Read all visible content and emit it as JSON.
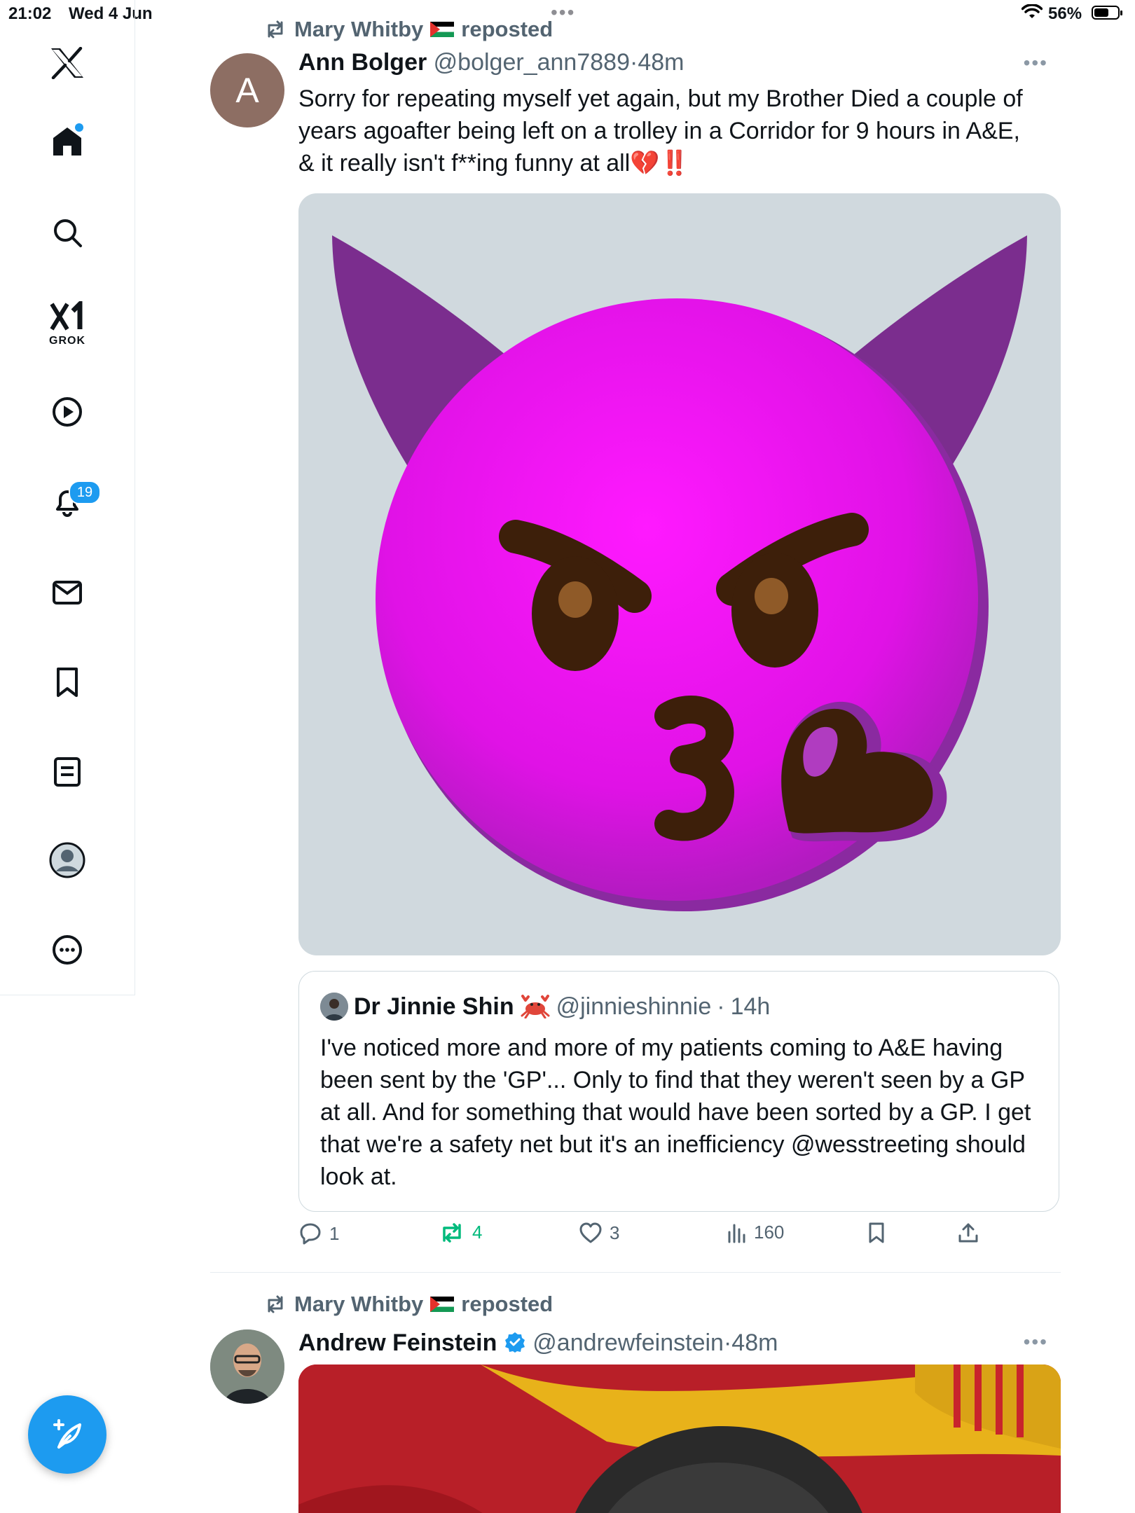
{
  "status_bar": {
    "time": "21:02",
    "date": "Wed 4 Jun",
    "battery": "56%"
  },
  "sidebar": {
    "items": [
      {
        "name": "x-logo"
      },
      {
        "name": "home"
      },
      {
        "name": "search"
      },
      {
        "name": "grok",
        "label": "GROK"
      },
      {
        "name": "video"
      },
      {
        "name": "notifications",
        "badge": "19"
      },
      {
        "name": "messages"
      },
      {
        "name": "bookmarks"
      },
      {
        "name": "lists"
      },
      {
        "name": "profile"
      },
      {
        "name": "more"
      }
    ]
  },
  "posts": [
    {
      "repost_by": "Mary Whitby",
      "repost_label": "reposted",
      "avatar_letter": "A",
      "author_name": "Ann Bolger",
      "author_handle": "@bolger_ann7889",
      "time": "48m",
      "text": "Sorry for repeating myself yet again, but my Brother Died a couple of years agoafter being left on a trolley in a  Corridor for 9 hours in A&E, & it really isn't f**ing funny at all💔‼️",
      "quote": {
        "author_name": "Dr Jinnie Shin",
        "author_handle": "@jinnieshinnie",
        "time": "14h",
        "text": "I've noticed more and more of my patients coming to A&E having been sent by the 'GP'... Only to find that they weren't seen by a GP at all. And for something that would have been sorted by a GP. I get that we're a safety net but it's an inefficiency @wesstreeting should look at."
      },
      "stats": {
        "replies": "1",
        "reposts": "4",
        "likes": "3",
        "views": "160"
      }
    },
    {
      "repost_by": "Mary Whitby",
      "repost_label": "reposted",
      "author_name": "Andrew Feinstein",
      "author_handle": "@andrewfeinstein",
      "time": "48m"
    }
  ],
  "colors": {
    "accent": "#1d9bf0",
    "repost_green": "#00ba7c",
    "secondary_text": "#536471"
  }
}
